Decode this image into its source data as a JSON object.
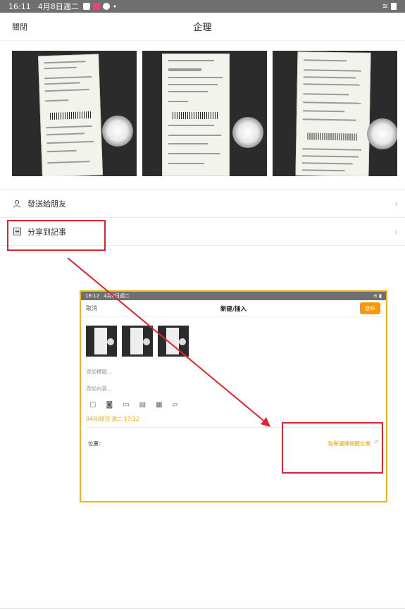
{
  "status_bar": {
    "time": "16:11",
    "date": "4月8日週二",
    "dot": "•"
  },
  "header": {
    "close_label": "關閉",
    "title": "企理"
  },
  "photos": [
    "receipt-photo-1",
    "receipt-photo-2",
    "receipt-photo-3"
  ],
  "actions": [
    {
      "label": "發送給朋友",
      "icon": "person-icon"
    },
    {
      "label": "分享到記事",
      "icon": "note-icon"
    }
  ],
  "embedded_screenshot": {
    "status_time": "16:12",
    "status_date": "4月8日週二",
    "cancel_label": "取消",
    "title": "新建/插入",
    "publish_label": "發布",
    "title_placeholder": "添加標題...",
    "content_placeholder": "添加內容...",
    "datetime": "04月08日 週二 17:12",
    "location_label": "位置：",
    "location_value": "點擊選擇提醒位置",
    "chevron": ">"
  },
  "colors": {
    "highlight_red": "#e0242d",
    "highlight_yellow": "#f5b400",
    "accent_orange": "#ff9800"
  }
}
